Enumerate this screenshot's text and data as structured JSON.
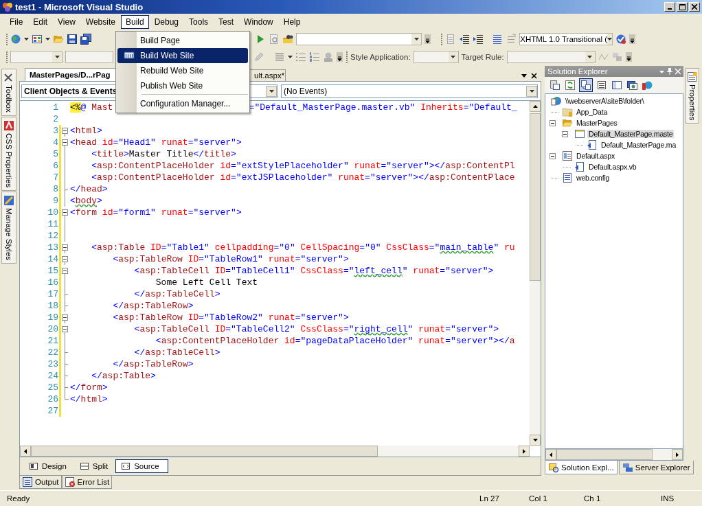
{
  "window": {
    "title": "test1 - Microsoft Visual Studio"
  },
  "menu_bar": [
    {
      "label": "File",
      "selected": false
    },
    {
      "label": "Edit",
      "selected": false
    },
    {
      "label": "View",
      "selected": false
    },
    {
      "label": "Website",
      "selected": false
    },
    {
      "label": "Build",
      "selected": true
    },
    {
      "label": "Debug",
      "selected": false
    },
    {
      "label": "Tools",
      "selected": false
    },
    {
      "label": "Test",
      "selected": false
    },
    {
      "label": "Window",
      "selected": false
    },
    {
      "label": "Help",
      "selected": false
    }
  ],
  "build_menu": [
    {
      "kind": "item",
      "label": "Build Page",
      "selected": false
    },
    {
      "kind": "item",
      "label": "Build Web Site",
      "selected": true
    },
    {
      "kind": "item",
      "label": "Rebuild Web Site",
      "selected": false
    },
    {
      "kind": "item",
      "label": "Publish Web Site",
      "selected": false
    },
    {
      "kind": "separator"
    },
    {
      "kind": "item",
      "label": "Configuration Manager...",
      "selected": false
    }
  ],
  "toolbars": {
    "doc_type": "XHTML 1.0 Transitional (",
    "style_application_label": "Style Application:",
    "target_rule_label": "Target Rule:"
  },
  "left_tool_tabs": [
    "Toolbox",
    "CSS Properties",
    "Manage Styles"
  ],
  "editor": {
    "tabs": [
      {
        "label": "MasterPages/D...rPag",
        "selected": true
      },
      {
        "label": "ult.aspx*",
        "selected": false
      }
    ],
    "object_combo": "Client Objects & Events",
    "event_combo": "(No Events)",
    "lines": [
      {
        "number": "1",
        "kind": "plain",
        "modified": false,
        "segments": [
          {
            "kind": "directive",
            "text": "<%"
          },
          {
            "kind": "delim",
            "text": "@ "
          },
          {
            "kind": "tag",
            "text": "Mast"
          },
          {
            "kind": "gap"
          },
          {
            "kind": "value",
            "text": "=\"Default_MasterPage.master.vb\""
          },
          {
            "kind": "attr",
            "text": " Inherits"
          },
          {
            "kind": "value",
            "text": "=\"Default_"
          }
        ]
      },
      {
        "number": "2",
        "kind": "plain",
        "modified": false
      },
      {
        "number": "3",
        "kind": "fold_open",
        "modified": true,
        "segments": [
          {
            "kind": "delim",
            "text": "<"
          },
          {
            "kind": "tag",
            "text": "html"
          },
          {
            "kind": "delim",
            "text": ">"
          }
        ]
      },
      {
        "number": "4",
        "kind": "fold_open",
        "modified": true,
        "segments": [
          {
            "kind": "delim",
            "text": "<"
          },
          {
            "kind": "tag",
            "text": "head"
          },
          {
            "kind": "attr",
            "text": " id"
          },
          {
            "kind": "value",
            "text": "=\"Head1\""
          },
          {
            "kind": "attr",
            "text": " runat"
          },
          {
            "kind": "value",
            "text": "=\"server\""
          },
          {
            "kind": "delim",
            "text": ">"
          }
        ]
      },
      {
        "number": "5",
        "kind": "fold_through",
        "modified": true,
        "segments": [
          {
            "kind": "delim",
            "text": "    <"
          },
          {
            "kind": "tag",
            "text": "title"
          },
          {
            "kind": "delim",
            "text": ">"
          },
          {
            "kind": "text",
            "text": "Master Title"
          },
          {
            "kind": "delim",
            "text": "</"
          },
          {
            "kind": "tag",
            "text": "title"
          },
          {
            "kind": "delim",
            "text": ">"
          }
        ]
      },
      {
        "number": "6",
        "kind": "fold_through",
        "modified": true,
        "segments": [
          {
            "kind": "delim",
            "text": "    <"
          },
          {
            "kind": "tag",
            "text": "asp:ContentPlaceHolder"
          },
          {
            "kind": "attr",
            "text": " id"
          },
          {
            "kind": "value",
            "text": "=\"extStylePlaceholder\""
          },
          {
            "kind": "attr",
            "text": " runat"
          },
          {
            "kind": "value",
            "text": "=\"server\""
          },
          {
            "kind": "delim",
            "text": "></"
          },
          {
            "kind": "tag",
            "text": "asp:ContentPl"
          }
        ]
      },
      {
        "number": "7",
        "kind": "fold_through",
        "modified": true,
        "segments": [
          {
            "kind": "delim",
            "text": "    <"
          },
          {
            "kind": "tag",
            "text": "asp:ContentPlaceHolder"
          },
          {
            "kind": "attr",
            "text": " id"
          },
          {
            "kind": "value",
            "text": "=\"extJSPlaceholder\""
          },
          {
            "kind": "attr",
            "text": " runat"
          },
          {
            "kind": "value",
            "text": "=\"server\""
          },
          {
            "kind": "delim",
            "text": "></"
          },
          {
            "kind": "tag",
            "text": "asp:ContentPlace"
          }
        ]
      },
      {
        "number": "8",
        "kind": "fold_close",
        "modified": true,
        "segments": [
          {
            "kind": "delim",
            "text": "</"
          },
          {
            "kind": "tag",
            "text": "head"
          },
          {
            "kind": "delim",
            "text": ">"
          }
        ]
      },
      {
        "number": "9",
        "kind": "fold_through",
        "modified": true,
        "segments": [
          {
            "kind": "delim",
            "text": "<"
          },
          {
            "kind": "squiggle_tag",
            "text": "body"
          },
          {
            "kind": "delim",
            "text": ">"
          }
        ]
      },
      {
        "number": "10",
        "kind": "fold_open",
        "modified": true,
        "segments": [
          {
            "kind": "delim",
            "text": "<"
          },
          {
            "kind": "tag",
            "text": "form"
          },
          {
            "kind": "attr",
            "text": " id"
          },
          {
            "kind": "value",
            "text": "=\"form1\""
          },
          {
            "kind": "attr",
            "text": " runat"
          },
          {
            "kind": "value",
            "text": "=\"server\""
          },
          {
            "kind": "delim",
            "text": ">"
          }
        ]
      },
      {
        "number": "11",
        "kind": "fold_through",
        "modified": true
      },
      {
        "number": "12",
        "kind": "fold_through",
        "modified": true
      },
      {
        "number": "13",
        "kind": "fold_open",
        "modified": true,
        "segments": [
          {
            "kind": "delim",
            "text": "    <"
          },
          {
            "kind": "tag",
            "text": "asp:Table"
          },
          {
            "kind": "attr",
            "text": " ID"
          },
          {
            "kind": "value",
            "text": "=\"Table1\""
          },
          {
            "kind": "attr",
            "text": " cellpadding"
          },
          {
            "kind": "value",
            "text": "=\"0\""
          },
          {
            "kind": "attr",
            "text": " CellSpacing"
          },
          {
            "kind": "value",
            "text": "=\"0\""
          },
          {
            "kind": "attr",
            "text": " CssClass"
          },
          {
            "kind": "value",
            "text": "=\""
          },
          {
            "kind": "squiggle_value",
            "text": "main_table"
          },
          {
            "kind": "value",
            "text": "\""
          },
          {
            "kind": "attr",
            "text": " ru"
          }
        ]
      },
      {
        "number": "14",
        "kind": "fold_open",
        "modified": true,
        "segments": [
          {
            "kind": "delim",
            "text": "        <"
          },
          {
            "kind": "tag",
            "text": "asp:TableRow"
          },
          {
            "kind": "attr",
            "text": " ID"
          },
          {
            "kind": "value",
            "text": "=\"TableRow1\""
          },
          {
            "kind": "attr",
            "text": " runat"
          },
          {
            "kind": "value",
            "text": "=\"server\""
          },
          {
            "kind": "delim",
            "text": ">"
          }
        ]
      },
      {
        "number": "15",
        "kind": "fold_open",
        "modified": true,
        "segments": [
          {
            "kind": "delim",
            "text": "            <"
          },
          {
            "kind": "tag",
            "text": "asp:TableCell"
          },
          {
            "kind": "attr",
            "text": " ID"
          },
          {
            "kind": "value",
            "text": "=\"TableCell1\""
          },
          {
            "kind": "attr",
            "text": " CssClass"
          },
          {
            "kind": "value",
            "text": "=\""
          },
          {
            "kind": "squiggle_value",
            "text": "left_cell"
          },
          {
            "kind": "value",
            "text": "\""
          },
          {
            "kind": "attr",
            "text": " runat"
          },
          {
            "kind": "value",
            "text": "=\"server\""
          },
          {
            "kind": "delim",
            "text": ">"
          }
        ]
      },
      {
        "number": "16",
        "kind": "fold_through",
        "modified": true,
        "segments": [
          {
            "kind": "text",
            "text": "                Some Left Cell Text"
          }
        ]
      },
      {
        "number": "17",
        "kind": "fold_close",
        "modified": true,
        "segments": [
          {
            "kind": "delim",
            "text": "            </"
          },
          {
            "kind": "tag",
            "text": "asp:TableCell"
          },
          {
            "kind": "delim",
            "text": ">"
          }
        ]
      },
      {
        "number": "18",
        "kind": "fold_close",
        "modified": true,
        "segments": [
          {
            "kind": "delim",
            "text": "        </"
          },
          {
            "kind": "tag",
            "text": "asp:TableRow"
          },
          {
            "kind": "delim",
            "text": ">"
          }
        ]
      },
      {
        "number": "19",
        "kind": "fold_open",
        "modified": true,
        "segments": [
          {
            "kind": "delim",
            "text": "        <"
          },
          {
            "kind": "tag",
            "text": "asp:TableRow"
          },
          {
            "kind": "attr",
            "text": " ID"
          },
          {
            "kind": "value",
            "text": "=\"TableRow2\""
          },
          {
            "kind": "attr",
            "text": " runat"
          },
          {
            "kind": "value",
            "text": "=\"server\""
          },
          {
            "kind": "delim",
            "text": ">"
          }
        ]
      },
      {
        "number": "20",
        "kind": "fold_open",
        "modified": true,
        "segments": [
          {
            "kind": "delim",
            "text": "            <"
          },
          {
            "kind": "tag",
            "text": "asp:TableCell"
          },
          {
            "kind": "attr",
            "text": " ID"
          },
          {
            "kind": "value",
            "text": "=\"TableCell2\""
          },
          {
            "kind": "attr",
            "text": " CssClass"
          },
          {
            "kind": "value",
            "text": "=\""
          },
          {
            "kind": "squiggle_value",
            "text": "right_cell"
          },
          {
            "kind": "value",
            "text": "\""
          },
          {
            "kind": "attr",
            "text": " runat"
          },
          {
            "kind": "value",
            "text": "=\"server\""
          },
          {
            "kind": "delim",
            "text": ">"
          }
        ]
      },
      {
        "number": "21",
        "kind": "fold_through",
        "modified": true,
        "segments": [
          {
            "kind": "delim",
            "text": "                <"
          },
          {
            "kind": "tag",
            "text": "asp:ContentPlaceHolder"
          },
          {
            "kind": "attr",
            "text": " id"
          },
          {
            "kind": "value",
            "text": "=\"pageDataPlaceHolder\""
          },
          {
            "kind": "attr",
            "text": " runat"
          },
          {
            "kind": "value",
            "text": "=\"server\""
          },
          {
            "kind": "delim",
            "text": "></"
          },
          {
            "kind": "tag",
            "text": "a"
          }
        ]
      },
      {
        "number": "22",
        "kind": "fold_close",
        "modified": true,
        "segments": [
          {
            "kind": "delim",
            "text": "            </"
          },
          {
            "kind": "tag",
            "text": "asp:TableCell"
          },
          {
            "kind": "delim",
            "text": ">"
          }
        ]
      },
      {
        "number": "23",
        "kind": "fold_close",
        "modified": true,
        "segments": [
          {
            "kind": "delim",
            "text": "        </"
          },
          {
            "kind": "tag",
            "text": "asp:TableRow"
          },
          {
            "kind": "delim",
            "text": ">"
          }
        ]
      },
      {
        "number": "24",
        "kind": "fold_close",
        "modified": true,
        "segments": [
          {
            "kind": "delim",
            "text": "    </"
          },
          {
            "kind": "tag",
            "text": "asp:Table"
          },
          {
            "kind": "delim",
            "text": ">"
          }
        ]
      },
      {
        "number": "25",
        "kind": "fold_close",
        "modified": true,
        "segments": [
          {
            "kind": "delim",
            "text": "</"
          },
          {
            "kind": "tag",
            "text": "form"
          },
          {
            "kind": "delim",
            "text": ">"
          }
        ]
      },
      {
        "number": "26",
        "kind": "fold_last",
        "modified": true,
        "segments": [
          {
            "kind": "delim",
            "text": "</"
          },
          {
            "kind": "tag",
            "text": "html"
          },
          {
            "kind": "delim",
            "text": ">"
          }
        ]
      },
      {
        "number": "27",
        "kind": "plain",
        "modified": true
      }
    ],
    "view_tabs": [
      {
        "label": "Design",
        "selected": false
      },
      {
        "label": "Split",
        "selected": false
      },
      {
        "label": "Source",
        "selected": true
      }
    ]
  },
  "solution_explorer": {
    "title": "Solution Explorer",
    "tree": [
      {
        "kind": "site",
        "label": "\\\\webserverA\\siteB\\folder\\",
        "selected": false,
        "children": [
          {
            "kind": "data-folder",
            "label": "App_Data",
            "selected": false
          },
          {
            "kind": "open-folder",
            "label": "MasterPages",
            "selected": false,
            "expanded": true,
            "children": [
              {
                "kind": "master",
                "label": "Default_MasterPage.maste",
                "selected": true,
                "expanded": true,
                "children": [
                  {
                    "kind": "code",
                    "label": "Default_MasterPage.ma",
                    "selected": false
                  }
                ]
              }
            ]
          },
          {
            "kind": "page",
            "label": "Default.aspx",
            "selected": false,
            "expanded": true,
            "children": [
              {
                "kind": "code",
                "label": "Default.aspx.vb",
                "selected": false
              }
            ]
          },
          {
            "kind": "config",
            "label": "web.config",
            "selected": false
          }
        ]
      }
    ],
    "tabs": [
      {
        "label": "Solution Expl...",
        "selected": true
      },
      {
        "label": "Server Explorer",
        "selected": false
      }
    ]
  },
  "right_tool_tabs": [
    "Properties"
  ],
  "output_tabs": [
    {
      "label": "Output",
      "selected": false
    },
    {
      "label": "Error List",
      "selected": false
    }
  ],
  "status_bar": {
    "message": "Ready",
    "line": "Ln 27",
    "column": "Col 1",
    "char": "Ch 1",
    "mode": "INS"
  }
}
